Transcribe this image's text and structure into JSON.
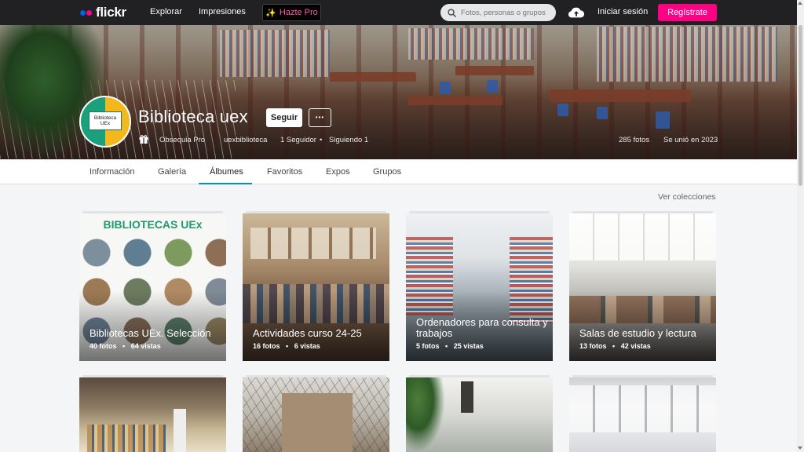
{
  "nav": {
    "logo": "flickr",
    "links": [
      "Explorar",
      "Impresiones"
    ],
    "pro_button": "Hazte Pro",
    "search_placeholder": "Fotos, personas o grupos",
    "login": "Iniciar sesión",
    "signup": "Regístrate",
    "colors": {
      "blue_dot": "#0063dc",
      "pink_dot": "#ff0084",
      "signup_bg": "#ff0084"
    }
  },
  "profile": {
    "avatar_text_1": "Biblioteca",
    "avatar_text_2": "UEx",
    "name": "Biblioteca uex",
    "follow": "Seguir",
    "more": "•••",
    "gift": "Obsequia Pro",
    "username": "uexbiblioteca",
    "followers": "1 Seguidor",
    "following": "Siguiendo 1",
    "photos": "285 fotos",
    "joined": "Se unió en 2023"
  },
  "tabs": [
    "Información",
    "Galería",
    "Álbumes",
    "Favoritos",
    "Expos",
    "Grupos"
  ],
  "active_tab": "Álbumes",
  "view_collections": "Ver colecciones",
  "albums": [
    {
      "title": "Bibliotecas UEx. Selección",
      "photos": "40 fotos",
      "views": "64 vistas",
      "banner": "BIBLIOTECAS UEx"
    },
    {
      "title": "Actividades curso 24-25",
      "photos": "16 fotos",
      "views": "6 vistas"
    },
    {
      "title": "Ordenadores para consulta y trabajos",
      "photos": "5 fotos",
      "views": "25 vistas"
    },
    {
      "title": "Salas de estudio y lectura",
      "photos": "13 fotos",
      "views": "42 vistas"
    },
    {
      "title": "",
      "photos": "",
      "views": ""
    },
    {
      "title": "",
      "photos": "",
      "views": ""
    },
    {
      "title": "",
      "photos": "",
      "views": ""
    },
    {
      "title": "",
      "photos": "",
      "views": ""
    }
  ],
  "stats_separator": "•"
}
